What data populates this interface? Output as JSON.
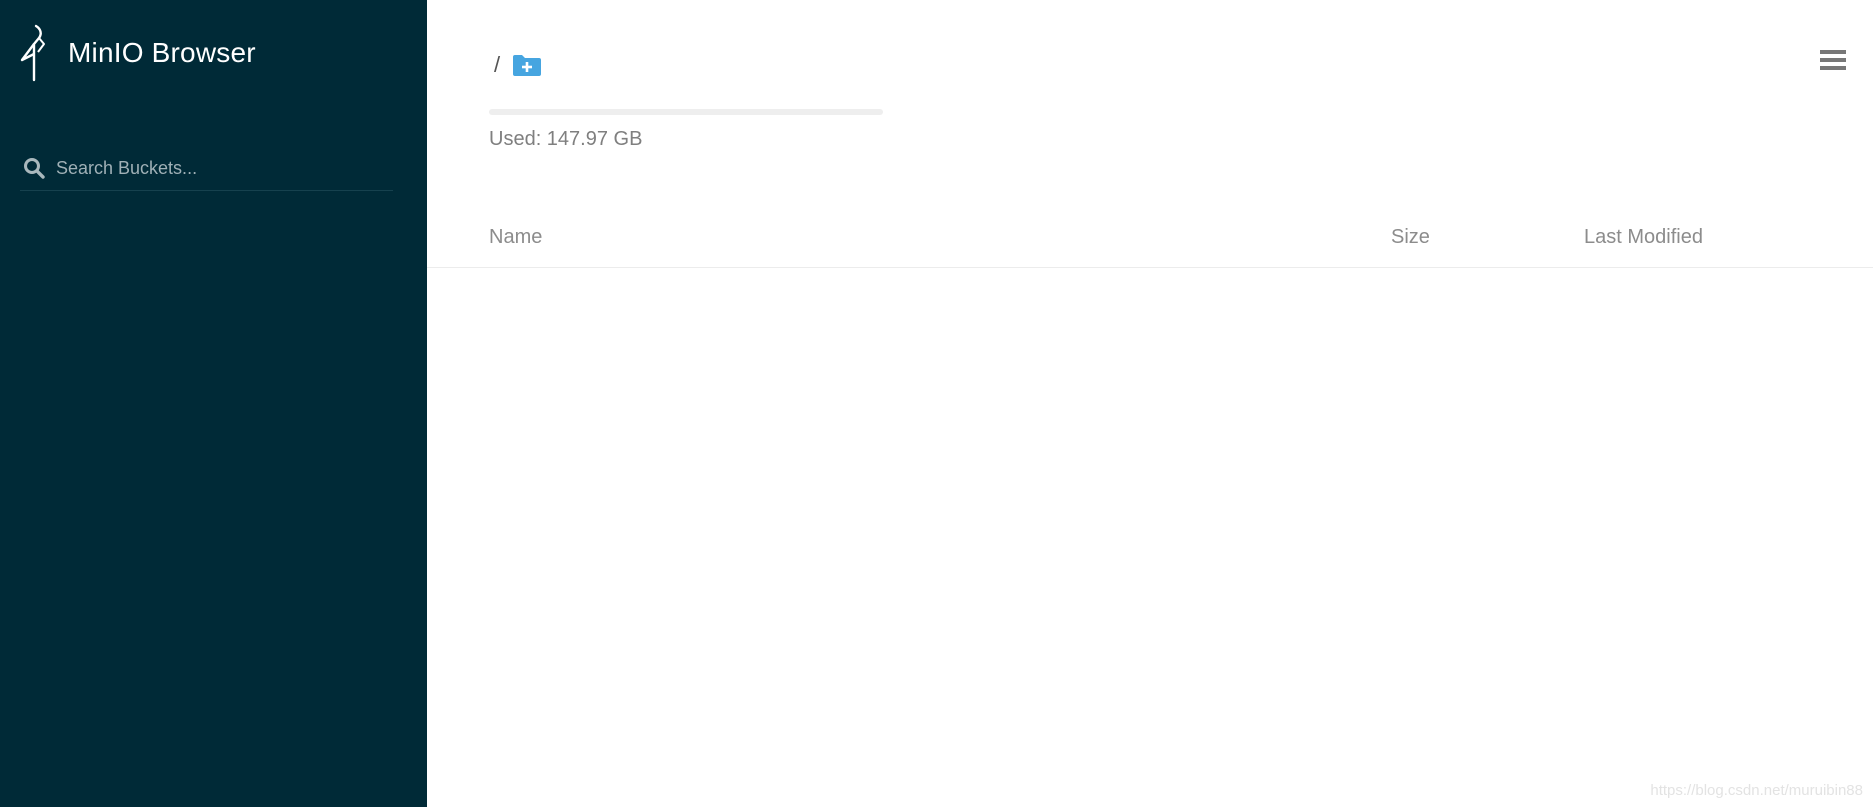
{
  "app": {
    "title": "MinIO Browser"
  },
  "sidebar": {
    "search": {
      "placeholder": "Search Buckets...",
      "value": "",
      "icon": "search-icon"
    },
    "background_color": "#002a37"
  },
  "main": {
    "breadcrumb": {
      "separator": "/",
      "new_folder_icon": "folder-plus-icon",
      "icon_color": "#46a5e0"
    },
    "storage": {
      "used_label": "Used: 147.97 GB",
      "usage_fraction": 0
    },
    "menu_icon": "hamburger-menu-icon",
    "table": {
      "columns": [
        "Name",
        "Size",
        "Last Modified"
      ],
      "rows": []
    }
  },
  "watermark": "https://blog.csdn.net/muruibin88"
}
